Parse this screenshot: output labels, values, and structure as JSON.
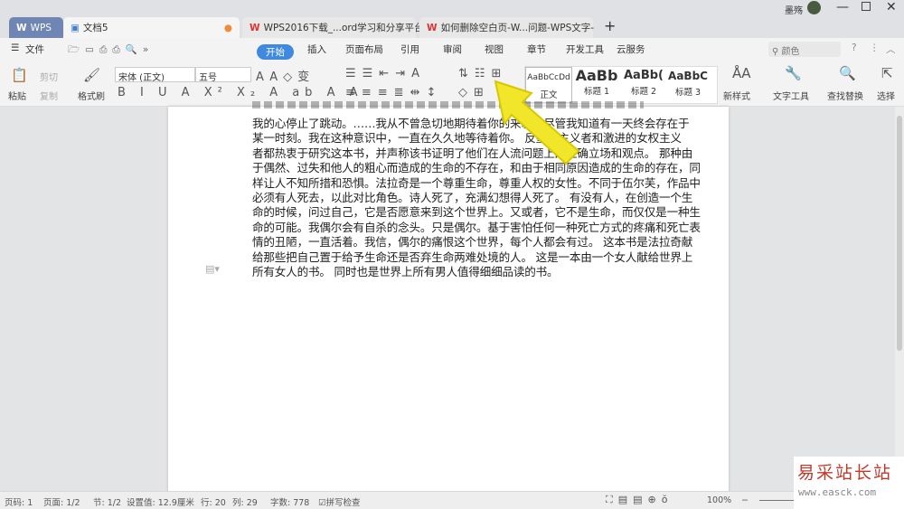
{
  "titlebar": {
    "user": "墨殇",
    "tabs": [
      {
        "label": "WPS"
      },
      {
        "label": "文档5"
      },
      {
        "label": "WPS2016下载_...ord学习和分享平台"
      },
      {
        "label": "如何删除空白页-W...问题-WPS文字-"
      }
    ],
    "new_tab": "+"
  },
  "menubar": {
    "file": "文件",
    "tabs": [
      "开始",
      "插入",
      "页面布局",
      "引用",
      "审阅",
      "视图",
      "章节",
      "开发工具",
      "云服务"
    ],
    "search_placeholder": "颜色"
  },
  "ribbon": {
    "paste": "粘贴",
    "cut": "剪切",
    "copy": "复制",
    "format_painter": "格式刷",
    "font": "宋体 (正文)",
    "size": "五号",
    "styles": [
      {
        "preview": "AaBbCcDd",
        "name": "正文"
      },
      {
        "preview": "AaBb",
        "name": "标题 1"
      },
      {
        "preview": "AaBb(",
        "name": "标题 2"
      },
      {
        "preview": "AaBbC",
        "name": "标题 3"
      }
    ],
    "new_style": "新样式",
    "text_tools": "文字工具",
    "find_replace": "查找替换",
    "select": "选择"
  },
  "document": {
    "lines": [
      "我的心停止了跳动。……我从不曾急切地期待着你的来临，尽管我知道有一天终会存在于",
      "某一时刻。我在这种意识中，一直在久久地等待着你。 反堕胎主义者和激进的女权主义",
      "者都热衷于研究这本书，并声称该书证明了他们在人流问题上的正确立场和观点。 那种由",
      "于偶然、过失和他人的粗心而造成的生命的不存在，和由于相同原因造成的生命的存在，同",
      "样让人不知所措和恐惧。法拉奇是一个尊重生命，尊重人权的女性。不同于伍尔芙，作品中",
      "必须有人死去，以此对比角色。诗人死了，充满幻想得人死了。 有没有人，在创造一个生",
      "命的时候，问过自己，它是否愿意来到这个世界上。又或者，它不是生命，而仅仅是一种生",
      "命的可能。我偶尔会有自杀的念头。只是偶尔。基于害怕任何一种死亡方式的疼痛和死亡表",
      "情的丑陋，一直活着。我信，偶尔的痛恨这个世界，每个人都会有过。 这本书是法拉奇献",
      "给那些把自己置于给予生命还是否弃生命两难处境的人。 这是一本由一个女人献给世界上",
      "所有女人的书。 同时也是世界上所有男人值得细细品读的书。"
    ]
  },
  "status": {
    "page_no": "页码: 1",
    "pages": "页面: 1/2",
    "section": "节: 1/2",
    "setting": "设置值: 12.9厘米",
    "row": "行: 20",
    "col": "列: 29",
    "words": "字数: 778",
    "spell": "拼写检查",
    "zoom": "100%"
  },
  "watermark": {
    "logo": "易采站长站",
    "url": "www.easck.com"
  },
  "colors": {
    "accent": "#3f8ae0",
    "cursor": "#f2e62a"
  }
}
